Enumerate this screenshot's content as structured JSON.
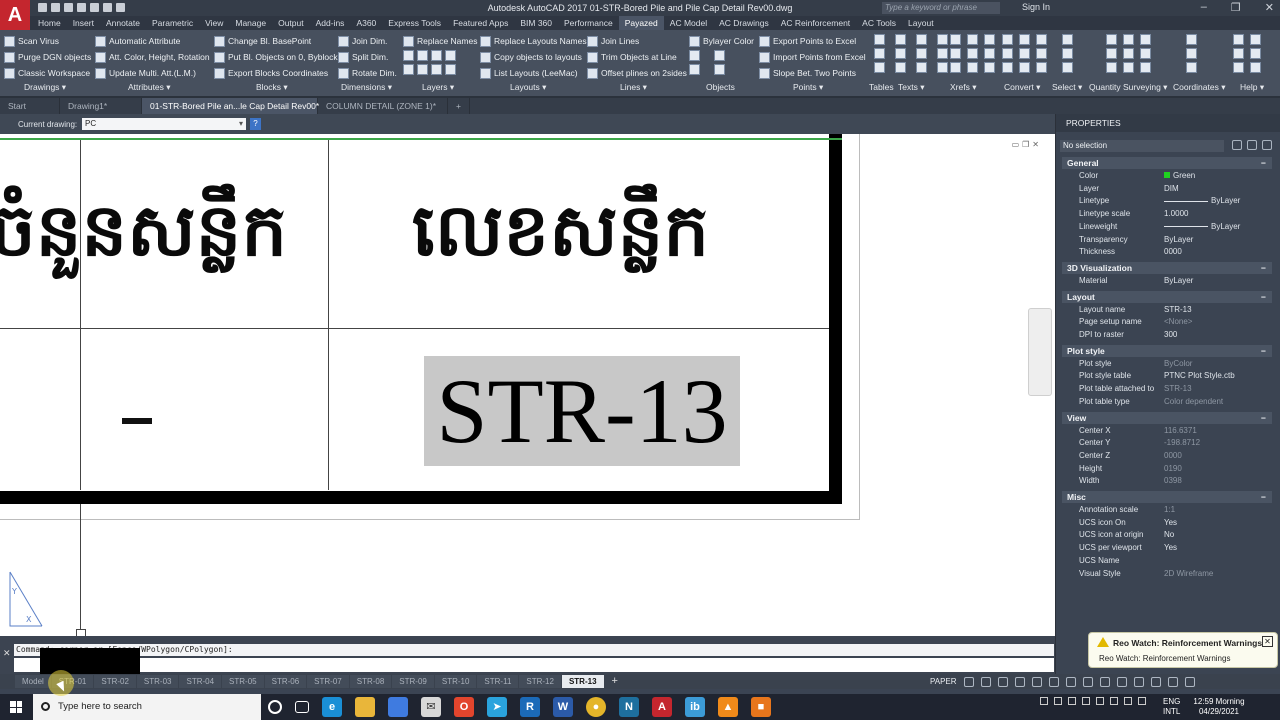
{
  "window": {
    "title": "Autodesk AutoCAD 2017    01-STR-Bored Pile and Pile Cap Detail Rev00.dwg",
    "search_placeholder": "Type a keyword or phrase",
    "sign_in": "Sign In",
    "logo": "A"
  },
  "ribbon_tabs": [
    "Home",
    "Insert",
    "Annotate",
    "Parametric",
    "View",
    "Manage",
    "Output",
    "Add-ins",
    "A360",
    "Express Tools",
    "Featured Apps",
    "BIM 360",
    "Performance",
    "Payazed",
    "AC Model",
    "AC Drawings",
    "AC Reinforcement",
    "AC Tools",
    "Layout"
  ],
  "ribbon": {
    "col1": [
      "Scan Virus",
      "Purge DGN objects",
      "Classic Workspace"
    ],
    "col2": [
      "Automatic Attribute",
      "Att. Color, Height, Rotation",
      "Update Multi. Att.(L.M.)"
    ],
    "col3": [
      "Change Bl. BasePoint",
      "Put Bl. Objects on 0, Byblock",
      "Export Blocks Coordinates"
    ],
    "col4": [
      "Join Dim.",
      "Split Dim.",
      "Rotate Dim."
    ],
    "col5": [
      "Replace Names"
    ],
    "col6": [
      "Replace Layouts Names",
      "Copy objects to layouts",
      "List Layouts (LeeMac)"
    ],
    "col7": [
      "Join Lines",
      "Trim Objects at Line",
      "Offset plines on 2sides"
    ],
    "col8": [
      "Bylayer Color"
    ],
    "col9": [
      "Export Points to Excel",
      "Import Points from Excel",
      "Slope Bet. Two Points"
    ],
    "groups": [
      "Drawings ▾",
      "Attributes ▾",
      "Blocks ▾",
      "Dimensions ▾",
      "Layers ▾",
      "Layouts ▾",
      "Lines ▾",
      "Objects",
      "Points ▾",
      "Tables",
      "Texts ▾",
      "Xrefs ▾",
      "Convert ▾",
      "Select ▾",
      "Quantity Surveying ▾",
      "Coordinates ▾",
      "Help ▾"
    ]
  },
  "doc_tabs": [
    "Start",
    "Drawing1*",
    "01-STR-Bored Pile an...le Cap Detail Rev00*",
    "COLUMN DETAIL (ZONE 1)*"
  ],
  "current_drawing": {
    "label": "Current drawing:",
    "value": "PC"
  },
  "drawing": {
    "khmer_left": "ចំនួនសន្លឹក",
    "khmer_right": "លេខសន្លឹក",
    "dash": "-",
    "sheet_number": "STR-13"
  },
  "command": {
    "line": "Command:                    corner or [Fence/WPolygon/CPolygon]:",
    "prompt_icon": "command-prompt-icon"
  },
  "layout_tabs": [
    "Model",
    "STR-01",
    "STR-02",
    "STR-03",
    "STR-04",
    "STR-05",
    "STR-06",
    "STR-07",
    "STR-08",
    "STR-09",
    "STR-10",
    "STR-11",
    "STR-12",
    "STR-13"
  ],
  "active_layout": "STR-13",
  "status": {
    "paper": "PAPER"
  },
  "properties": {
    "title": "PROPERTIES",
    "selection": "No selection",
    "sections": [
      {
        "name": "General",
        "rows": [
          [
            "Color",
            "Green"
          ],
          [
            "Layer",
            "DIM"
          ],
          [
            "Linetype",
            "ByLayer"
          ],
          [
            "Linetype scale",
            "1.0000"
          ],
          [
            "Lineweight",
            "ByLayer"
          ],
          [
            "Transparency",
            "ByLayer"
          ],
          [
            "Thickness",
            "0000"
          ]
        ]
      },
      {
        "name": "3D Visualization",
        "rows": [
          [
            "Material",
            "ByLayer"
          ]
        ]
      },
      {
        "name": "Layout",
        "rows": [
          [
            "Layout name",
            "STR-13"
          ],
          [
            "Page setup name",
            "<None>"
          ],
          [
            "DPI to raster",
            "300"
          ]
        ]
      },
      {
        "name": "Plot style",
        "rows": [
          [
            "Plot style",
            "ByColor"
          ],
          [
            "Plot style table",
            "PTNC Plot Style.ctb"
          ],
          [
            "Plot table attached to",
            "STR-13"
          ],
          [
            "Plot table type",
            "Color dependent"
          ]
        ]
      },
      {
        "name": "View",
        "rows": [
          [
            "Center X",
            "116.6371"
          ],
          [
            "Center Y",
            "-198.8712"
          ],
          [
            "Center Z",
            "0000"
          ],
          [
            "Height",
            "0190"
          ],
          [
            "Width",
            "0398"
          ]
        ]
      },
      {
        "name": "Misc",
        "rows": [
          [
            "Annotation scale",
            "1:1"
          ],
          [
            "UCS icon On",
            "Yes"
          ],
          [
            "UCS icon at origin",
            "No"
          ],
          [
            "UCS per viewport",
            "Yes"
          ],
          [
            "UCS Name",
            ""
          ],
          [
            "Visual Style",
            "2D Wireframe"
          ]
        ]
      }
    ],
    "green_hex": "#1fd11f"
  },
  "notification": {
    "title": "Reo Watch: Reinforcement Warnings",
    "body": "Reo Watch: Reinforcement Warnings"
  },
  "taskbar": {
    "search": "Type here to search",
    "lang1": "ENG",
    "lang2": "INTL",
    "time": "12:59 Morning",
    "date": "04/29/2021"
  }
}
